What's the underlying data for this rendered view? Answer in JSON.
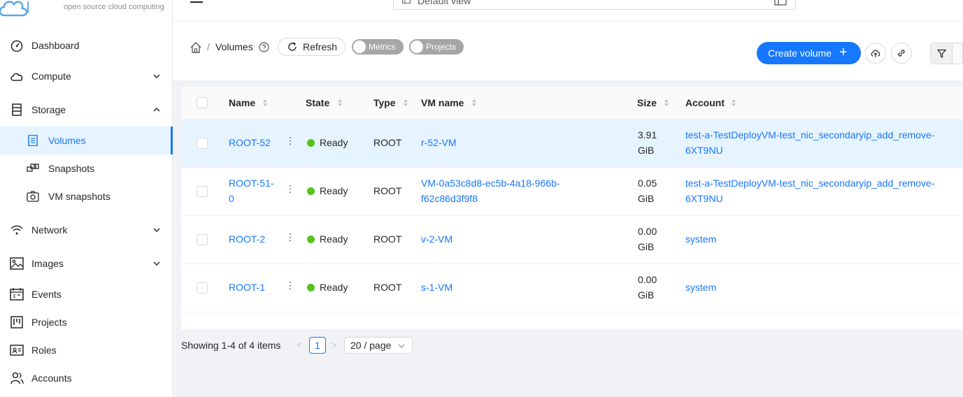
{
  "logo": {
    "tagline": "open source cloud computing"
  },
  "sidebar": {
    "items": [
      {
        "label": "Dashboard"
      },
      {
        "label": "Compute"
      },
      {
        "label": "Storage"
      },
      {
        "label": "Volumes"
      },
      {
        "label": "Snapshots"
      },
      {
        "label": "VM snapshots"
      },
      {
        "label": "Network"
      },
      {
        "label": "Images"
      },
      {
        "label": "Events"
      },
      {
        "label": "Projects"
      },
      {
        "label": "Roles"
      },
      {
        "label": "Accounts"
      }
    ]
  },
  "header": {
    "view_select": "Default view"
  },
  "breadcrumb": {
    "sep": "/",
    "title": "Volumes"
  },
  "toolbar": {
    "refresh": "Refresh",
    "metrics": "Metrics",
    "projects": "Projects",
    "create_volume": "Create volume",
    "plus": "+"
  },
  "table": {
    "columns": [
      "Name",
      "State",
      "Type",
      "VM name",
      "Size",
      "Account"
    ],
    "rows": [
      {
        "name": "ROOT-52",
        "state": "Ready",
        "type": "ROOT",
        "vm_name": "r-52-VM",
        "size_num": "3.91",
        "size_unit": "GiB",
        "account_l1": "test-a-TestDeployVM-test_nic_secondaryip_add_remove-",
        "account_l2": "6XT9NU"
      },
      {
        "name_l1": "ROOT-51-",
        "name_l2": "0",
        "state": "Ready",
        "type": "ROOT",
        "vm_l1": "VM-0a53c8d8-ec5b-4a18-966b-",
        "vm_l2": "f62c86d3f9f8",
        "size_num": "0.05",
        "size_unit": "GiB",
        "account_l1": "test-a-TestDeployVM-test_nic_secondaryip_add_remove-",
        "account_l2": "6XT9NU"
      },
      {
        "name": "ROOT-2",
        "state": "Ready",
        "type": "ROOT",
        "vm_name": "v-2-VM",
        "size_num": "0.00",
        "size_unit": "GiB",
        "account": "system"
      },
      {
        "name": "ROOT-1",
        "state": "Ready",
        "type": "ROOT",
        "vm_name": "s-1-VM",
        "size_num": "0.00",
        "size_unit": "GiB",
        "account": "system"
      }
    ]
  },
  "pagination": {
    "summary": "Showing 1-4 of 4 items",
    "current": "1",
    "prev": "<",
    "next": ">",
    "page_size": "20 / page"
  },
  "colors": {
    "accent": "#1677ff",
    "ready": "#52c41a",
    "selected_row": "#e6f4ff"
  }
}
